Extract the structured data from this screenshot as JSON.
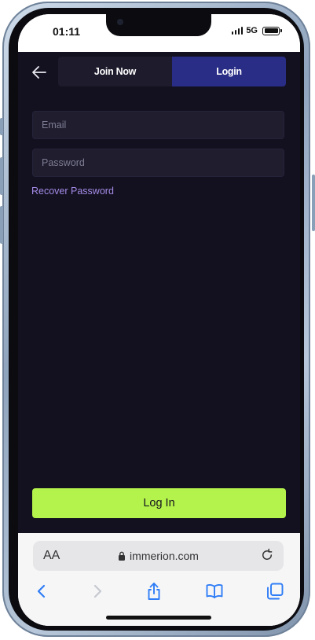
{
  "status_bar": {
    "time": "01:11",
    "network": "5G"
  },
  "tabs": [
    {
      "label": "Join Now",
      "active": false
    },
    {
      "label": "Login",
      "active": true
    }
  ],
  "form": {
    "email_placeholder": "Email",
    "password_placeholder": "Password",
    "recover_label": "Recover Password",
    "submit_label": "Log In"
  },
  "browser": {
    "text_size_label": "AA",
    "domain": "immerion.com"
  },
  "colors": {
    "background": "#13111f",
    "tab_active": "#2a2d86",
    "accent_button": "#b4f34b",
    "link": "#a58be8"
  },
  "icons": [
    "back-arrow-icon",
    "lock-icon",
    "reload-icon",
    "chevron-left-icon",
    "chevron-right-icon",
    "share-icon",
    "bookmarks-icon",
    "tabs-icon"
  ]
}
